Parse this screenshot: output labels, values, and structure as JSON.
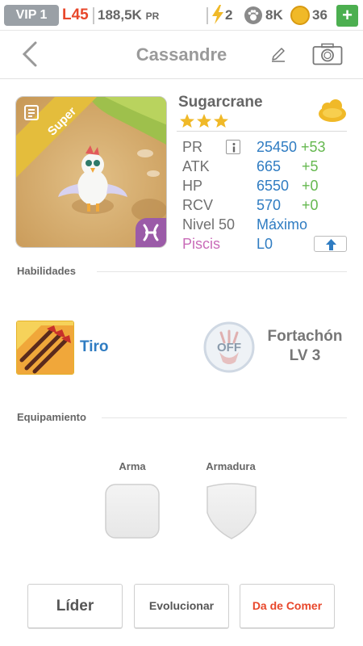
{
  "status_bar": {
    "vip_label": "VIP 1",
    "level": "L45",
    "power_value": "188,5K",
    "power_unit": "PR",
    "energy": "2",
    "paw_points": "8K",
    "coins": "36",
    "add_label": "+"
  },
  "header": {
    "title": "Cassandre"
  },
  "pet": {
    "rarity": "Super",
    "name": "Sugarcrane",
    "stars": 3,
    "stats": [
      {
        "label": "PR",
        "value": "25450",
        "bonus": "+53"
      },
      {
        "label": "ATK",
        "value": "665",
        "bonus": "+5"
      },
      {
        "label": "HP",
        "value": "6550",
        "bonus": "+0"
      },
      {
        "label": "RCV",
        "value": "570",
        "bonus": "+0"
      }
    ],
    "level_label": "Nivel 50",
    "level_value": "Máximo",
    "sign_label": "Piscis",
    "sign_value": "L0"
  },
  "skills": {
    "section_title": "Habilidades",
    "active_name": "Tiro",
    "passive_state": "OFF",
    "passive_name": "Fortachón",
    "passive_level": "LV 3"
  },
  "equipment": {
    "section_title": "Equipamiento",
    "weapon_label": "Arma",
    "armor_label": "Armadura"
  },
  "actions": {
    "leader_label": "Líder",
    "evolve_label": "Evolucionar",
    "feed_label": "Da de Comer"
  },
  "colors": {
    "accent_blue": "#2f7cc2",
    "bonus_green": "#65b84f",
    "alert_red": "#e8472b",
    "piscis_purple": "#c96bb8"
  }
}
